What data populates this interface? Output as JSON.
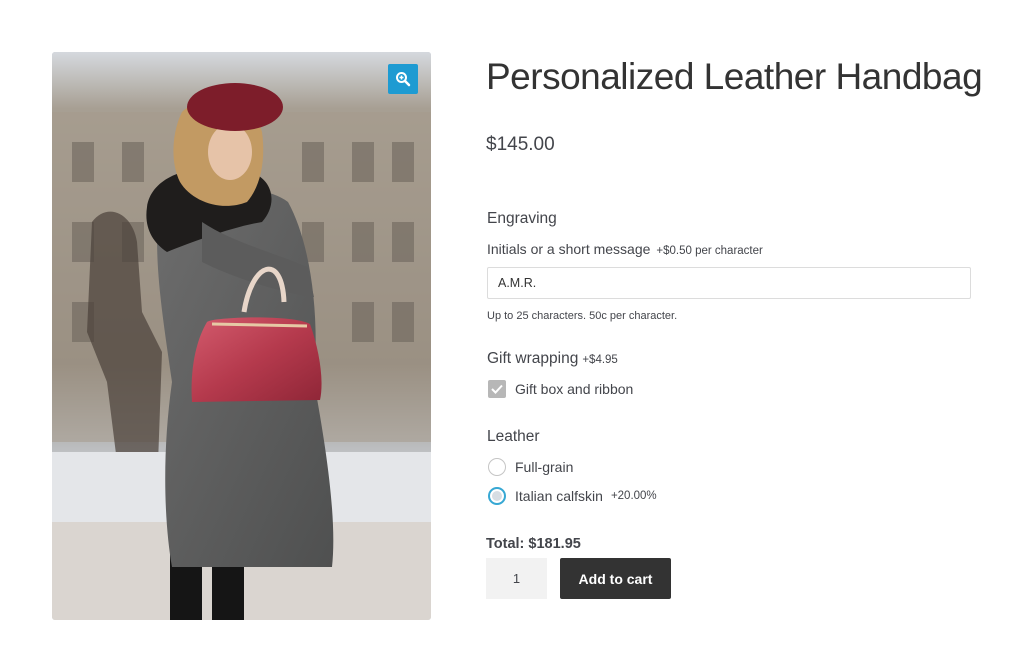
{
  "product": {
    "title": "Personalized Leather Handbag",
    "price": "$145.00",
    "image_alt": "Woman in grey coat and red beret holding a red leather handbag",
    "zoom_icon": "zoom-in-icon"
  },
  "engraving": {
    "heading": "Engraving",
    "field_label": "Initials or a short message",
    "field_price": "+$0.50 per character",
    "value": "A.M.R.",
    "help": "Up to 25 characters. 50c per character."
  },
  "gift_wrapping": {
    "heading": "Gift wrapping",
    "price": "+$4.95",
    "option_label": "Gift box and ribbon",
    "checked": true
  },
  "leather": {
    "heading": "Leather",
    "options": [
      {
        "label": "Full-grain",
        "extra": "",
        "selected": false
      },
      {
        "label": "Italian calfskin",
        "extra": "+20.00%",
        "selected": true
      }
    ]
  },
  "total": "Total: $181.95",
  "quantity": "1",
  "add_to_cart": "Add to cart",
  "colors": {
    "accent": "#1e9bd2",
    "button": "#333333",
    "text": "#43454b"
  }
}
